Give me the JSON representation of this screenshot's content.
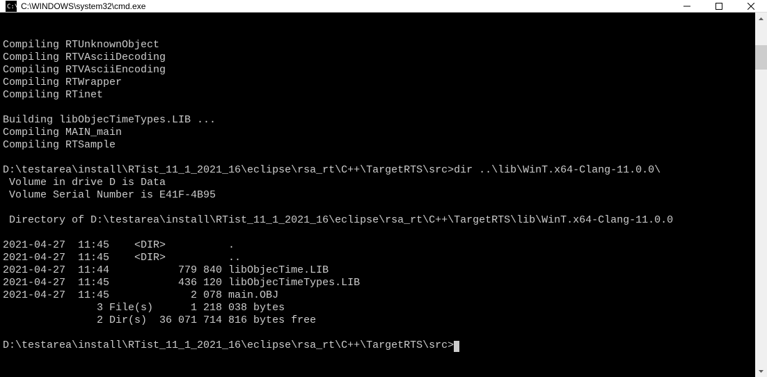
{
  "window": {
    "title": "C:\\WINDOWS\\system32\\cmd.exe"
  },
  "terminal": {
    "lines": [
      "Compiling RTUnknownObject",
      "Compiling RTVAsciiDecoding",
      "Compiling RTVAsciiEncoding",
      "Compiling RTWrapper",
      "Compiling RTinet",
      "",
      "Building libObjecTimeTypes.LIB ...",
      "Compiling MAIN_main",
      "Compiling RTSample",
      "",
      "D:\\testarea\\install\\RTist_11_1_2021_16\\eclipse\\rsa_rt\\C++\\TargetRTS\\src>dir ..\\lib\\WinT.x64-Clang-11.0.0\\",
      " Volume in drive D is Data",
      " Volume Serial Number is E41F-4B95",
      "",
      " Directory of D:\\testarea\\install\\RTist_11_1_2021_16\\eclipse\\rsa_rt\\C++\\TargetRTS\\lib\\WinT.x64-Clang-11.0.0",
      "",
      "2021-04-27  11:45    <DIR>          .",
      "2021-04-27  11:45    <DIR>          ..",
      "2021-04-27  11:44           779 840 libObjecTime.LIB",
      "2021-04-27  11:45           436 120 libObjecTimeTypes.LIB",
      "2021-04-27  11:45             2 078 main.OBJ",
      "               3 File(s)      1 218 038 bytes",
      "               2 Dir(s)  36 071 714 816 bytes free",
      "",
      "D:\\testarea\\install\\RTist_11_1_2021_16\\eclipse\\rsa_rt\\C++\\TargetRTS\\src>"
    ]
  }
}
